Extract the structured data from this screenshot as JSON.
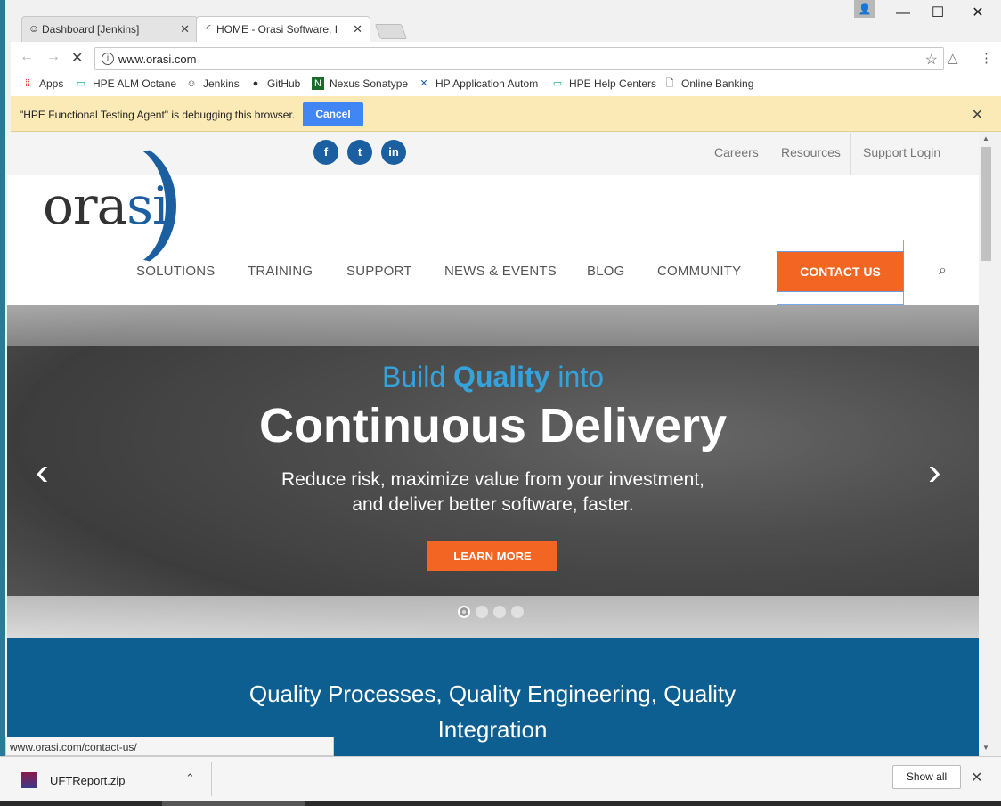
{
  "browser": {
    "tabs": [
      {
        "title": "Dashboard [Jenkins]",
        "icon": "jenkins-icon"
      },
      {
        "title": "HOME - Orasi Software, I",
        "icon": "loading-icon"
      }
    ],
    "url": "www.orasi.com",
    "bookmarks": [
      {
        "label": "Apps"
      },
      {
        "label": "HPE ALM Octane"
      },
      {
        "label": "Jenkins"
      },
      {
        "label": "GitHub"
      },
      {
        "label": "Nexus Sonatype"
      },
      {
        "label": "HP Application Autom"
      },
      {
        "label": "HPE Help Centers"
      },
      {
        "label": "Online Banking"
      }
    ],
    "infobar": {
      "message": "\"HPE Functional Testing Agent\" is debugging this browser.",
      "cancel_label": "Cancel"
    },
    "status_url": "www.orasi.com/contact-us/"
  },
  "site": {
    "top_links": [
      "Careers",
      "Resources",
      "Support Login"
    ],
    "social": [
      "f",
      "t",
      "in"
    ],
    "logo": {
      "main": "ora",
      "accent": "si"
    },
    "nav": [
      "SOLUTIONS",
      "TRAINING",
      "SUPPORT",
      "NEWS & EVENTS",
      "BLOG",
      "COMMUNITY"
    ],
    "contact_label": "CONTACT US",
    "hero": {
      "line1_pre": "Build ",
      "line1_bold": "Quality",
      "line1_post": " into",
      "headline": "Continuous Delivery",
      "sub1": "Reduce risk, maximize value from your investment,",
      "sub2": "and deliver better software, faster.",
      "cta": "LEARN MORE"
    },
    "band_title": "Quality Processes, Quality Engineering, Quality Integration"
  },
  "downloads": {
    "file": "UFTReport.zip",
    "show_all": "Show all"
  },
  "colors": {
    "brand_blue": "#1b5fa0",
    "accent_orange": "#f26522",
    "hero_blue": "#34a3dc",
    "band_blue": "#0d5f91"
  }
}
